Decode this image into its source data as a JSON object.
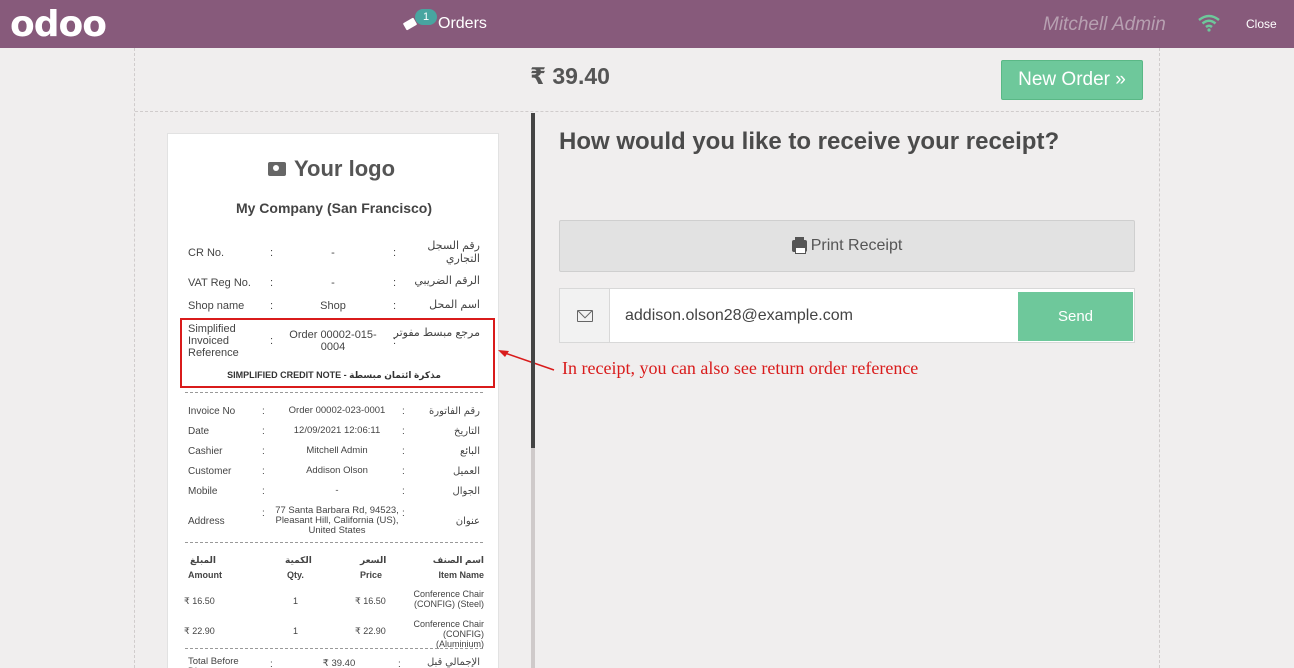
{
  "topbar": {
    "logo": "odoo",
    "orders_label": "Orders",
    "orders_badge": "1",
    "user": "Mitchell Admin",
    "close": "Close"
  },
  "header": {
    "total": "₹ 39.40",
    "new_order": "New Order »"
  },
  "receipt": {
    "logo_text": "Your logo",
    "company": "My Company (San Francisco)",
    "fields": [
      {
        "label": "CR No.",
        "value": "-",
        "arabic": "رقم السجل التجاري"
      },
      {
        "label": "VAT Reg No.",
        "value": "-",
        "arabic": "الرقم الضريبي"
      },
      {
        "label": "Shop name",
        "value": "Shop",
        "arabic": "اسم المحل"
      },
      {
        "label": "Simplified Invoiced Reference",
        "value": "Order 00002-015-0004",
        "arabic": "مرجع مبسط مفوتر"
      }
    ],
    "credit_note": "SIMPLIFIED CREDIT NOTE - مذكرة ائتمان مبسطة",
    "info": [
      {
        "label": "Invoice No",
        "value": "Order 00002-023-0001",
        "arabic": "رقم الفاتورة"
      },
      {
        "label": "Date",
        "value": "12/09/2021 12:06:11",
        "arabic": "التاريخ"
      },
      {
        "label": "Cashier",
        "value": "Mitchell Admin",
        "arabic": "البائع"
      },
      {
        "label": "Customer",
        "value": "Addison Olson",
        "arabic": "العميل"
      },
      {
        "label": "Mobile",
        "value": "-",
        "arabic": "الجوال"
      },
      {
        "label": "Address",
        "value": "77 Santa Barbara Rd, 94523, Pleasant Hill, California (US), United States",
        "arabic": "عنوان"
      }
    ],
    "table_headers": {
      "amount_ar": "المبلغ",
      "amount": "Amount",
      "qty_ar": "الكمية",
      "qty": "Qty.",
      "price_ar": "السعر",
      "price": "Price",
      "item_ar": "اسم الصنف",
      "item": "Item Name"
    },
    "lines": [
      {
        "amount": "₹ 16.50",
        "qty": "1",
        "price": "₹ 16.50",
        "item": "Conference Chair (CONFIG) (Steel)"
      },
      {
        "amount": "₹ 22.90",
        "qty": "1",
        "price": "₹ 22.90",
        "item": "Conference Chair (CONFIG) (Aluminium)"
      }
    ],
    "total_before": {
      "label": "Total Before Discount",
      "value": "₹ 39.40",
      "arabic": "الإجمالي قبل الخصم"
    }
  },
  "annotation": "In receipt, you can also see return order reference",
  "panel": {
    "question": "How would you like to receive your receipt?",
    "print_label": "Print Receipt",
    "email_value": "addison.olson28@example.com",
    "send_label": "Send"
  },
  "colors": {
    "topbar": "#875a7b",
    "accent_green": "#6ec89b",
    "annotation_red": "#d91b1b"
  },
  "icons": [
    "ticket-icon",
    "wifi-icon",
    "camera-icon",
    "printer-icon",
    "envelope-icon"
  ]
}
